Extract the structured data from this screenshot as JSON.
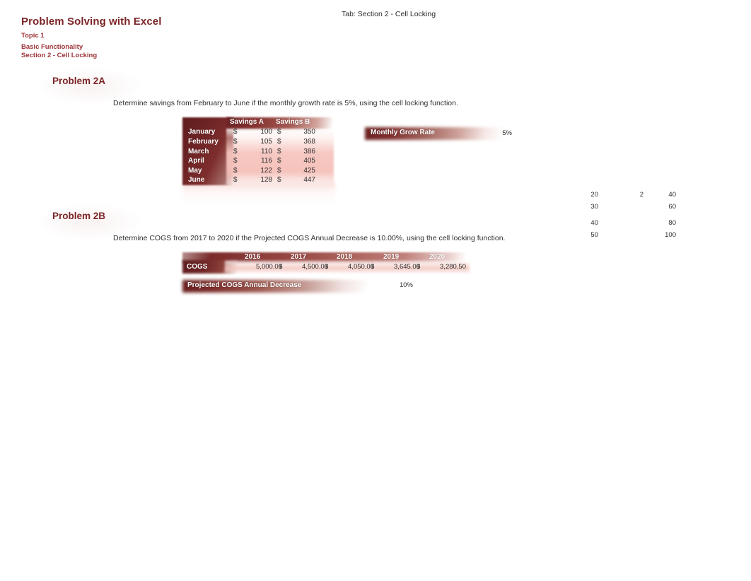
{
  "tab": {
    "label": "Tab: Section 2 - Cell Locking"
  },
  "header": {
    "title": "Problem Solving with Excel",
    "topic": "Topic 1",
    "subtitle_1": "Basic Functionality",
    "subtitle_2": "Section 2 - Cell Locking"
  },
  "colors": {
    "heading": "#7b2527",
    "subheading": "#9c3236",
    "band_dark": "#6d2324",
    "band_light": "#f5c4bd",
    "body_text": "#2f2f2f"
  },
  "problem_2a": {
    "heading": "Problem 2A",
    "prompt": "Determine savings from February to June if the monthly growth rate is 5%, using the cell locking function.",
    "table": {
      "columns": [
        "",
        "Savings A",
        "Savings B"
      ],
      "rows": [
        {
          "month": "January",
          "currency_a": "$",
          "savings_a": "100",
          "currency_b": "$",
          "savings_b": "350"
        },
        {
          "month": "February",
          "currency_a": "$",
          "savings_a": "105",
          "currency_b": "$",
          "savings_b": "368"
        },
        {
          "month": "March",
          "currency_a": "$",
          "savings_a": "110",
          "currency_b": "$",
          "savings_b": "386"
        },
        {
          "month": "April",
          "currency_a": "$",
          "savings_a": "116",
          "currency_b": "$",
          "savings_b": "405"
        },
        {
          "month": "May",
          "currency_a": "$",
          "savings_a": "122",
          "currency_b": "$",
          "savings_b": "425"
        },
        {
          "month": "June",
          "currency_a": "$",
          "savings_a": "128",
          "currency_b": "$",
          "savings_b": "447"
        }
      ]
    },
    "grow_rate": {
      "label": "Monthly Grow Rate",
      "value": "5%"
    }
  },
  "problem_2b": {
    "heading": "Problem 2B",
    "prompt": "Determine COGS from 2017 to 2020 if the Projected COGS Annual Decrease is 10.00%, using the cell locking function.",
    "table": {
      "row_label": "COGS",
      "years": [
        "2016",
        "2017",
        "2018",
        "2019",
        "2020"
      ],
      "currencies": [
        "",
        "$",
        "$",
        "$",
        "$"
      ],
      "values": [
        "5,000.00",
        "4,500.00",
        "4,050.00",
        "3,645.00",
        "3,280.50"
      ]
    },
    "annual_decrease": {
      "label": "Projected COGS Annual Decrease",
      "value": "10%"
    }
  },
  "scratch": {
    "rows": [
      {
        "a": "20",
        "b": "2",
        "c": "40"
      },
      {
        "a": "30",
        "b": "",
        "c": "60"
      },
      {
        "a": "40",
        "b": "",
        "c": "80"
      },
      {
        "a": "50",
        "b": "",
        "c": "100"
      }
    ]
  }
}
